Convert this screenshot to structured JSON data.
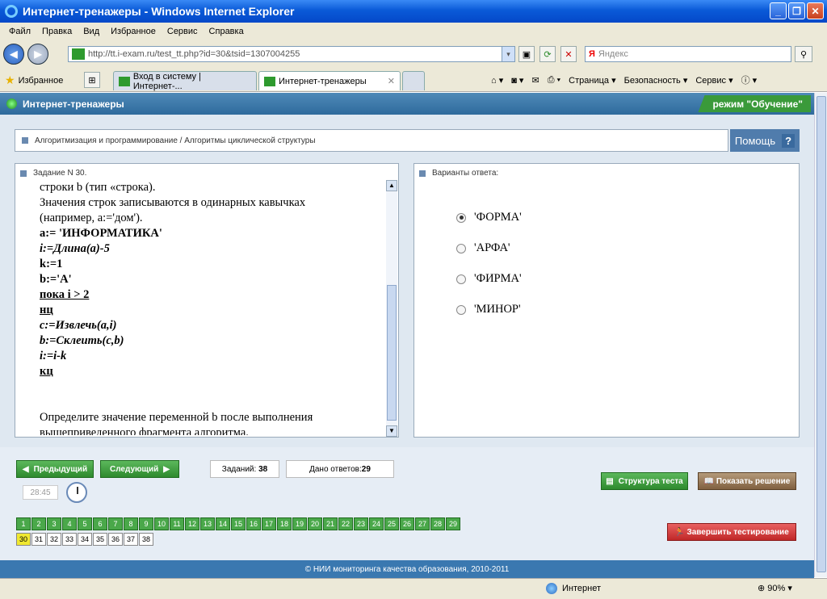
{
  "window": {
    "title": "Интернет-тренажеры - Windows Internet Explorer"
  },
  "menu": [
    "Файл",
    "Правка",
    "Вид",
    "Избранное",
    "Сервис",
    "Справка"
  ],
  "address": {
    "url": "http://tt.i-exam.ru/test_tt.php?id=30&tsid=1307004255",
    "search_placeholder": "Яндекс",
    "search_logo": "Я"
  },
  "favorites": {
    "label": "Избранное"
  },
  "tabs": [
    {
      "label": "Вход в систему | Интернет-..."
    },
    {
      "label": "Интернет-тренажеры"
    }
  ],
  "toolbar": {
    "page": "Страница ▾",
    "security": "Безопасность ▾",
    "service": "Сервис ▾"
  },
  "app": {
    "title": "Интернет-тренажеры",
    "mode": "режим \"Обучение\""
  },
  "breadcrumb": "Алгоритмизация и программирование / Алгоритмы циклической структуры",
  "help": {
    "label": "Помощь",
    "q": "?"
  },
  "task": {
    "title": "Задание N 30.",
    "lines": [
      {
        "t": "строки b (тип «строка).",
        "s": ""
      },
      {
        "t": "Значения строк записываются в одинарных кавычках",
        "s": ""
      },
      {
        "t": "(например, a:='дом').",
        "s": ""
      },
      {
        "t": "a:= 'ИНФОРМАТИКА'",
        "s": "b"
      },
      {
        "t": "i:=Длина(a)-5",
        "s": "bi"
      },
      {
        "t": "k:=1",
        "s": "b"
      },
      {
        "t": "b:='А'",
        "s": "b"
      },
      {
        "t": "пока  i > 2",
        "s": "u"
      },
      {
        "t": "нц",
        "s": "u"
      },
      {
        "t": "c:=Извлечь(a,i)",
        "s": "bi"
      },
      {
        "t": "b:=Склеить(c,b)",
        "s": "bi"
      },
      {
        "t": "i:=i-k",
        "s": "bi"
      },
      {
        "t": "кц",
        "s": "u"
      },
      {
        "t": "",
        "s": ""
      },
      {
        "t": "",
        "s": ""
      },
      {
        "t": "Определите значение переменной b после выполнения",
        "s": ""
      },
      {
        "t": "вышеприведенного фрагмента алгоритма.",
        "s": ""
      }
    ]
  },
  "answers": {
    "title": "Варианты ответа:",
    "options": [
      {
        "label": "'ФОРМА'",
        "selected": true
      },
      {
        "label": "'АРФА'",
        "selected": false
      },
      {
        "label": "'ФИРМА'",
        "selected": false
      },
      {
        "label": "'МИНОР'",
        "selected": false
      }
    ]
  },
  "nav": {
    "prev": "Предыдущий",
    "next": "Следующий"
  },
  "stats": {
    "tasks_label": "Заданий:",
    "tasks": "38",
    "answered_label": "Дано ответов:",
    "answered": "29"
  },
  "timer": "28:45",
  "buttons": {
    "structure": "Структура теста",
    "solution": "Показать решение",
    "finish": "Завершить тестирование"
  },
  "questions": {
    "total": 38,
    "current": 30,
    "answered_until": 29
  },
  "copyright": "© НИИ мониторинга качества образования, 2010-2011",
  "status": {
    "zone": "Интернет",
    "zoom": "90%"
  }
}
